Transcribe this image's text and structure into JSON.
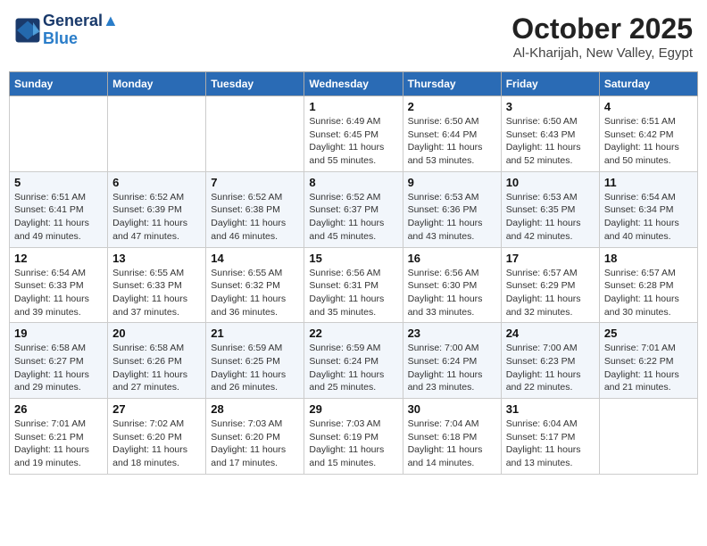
{
  "header": {
    "logo_line1": "General",
    "logo_line2": "Blue",
    "title": "October 2025",
    "subtitle": "Al-Kharijah, New Valley, Egypt"
  },
  "days_of_week": [
    "Sunday",
    "Monday",
    "Tuesday",
    "Wednesday",
    "Thursday",
    "Friday",
    "Saturday"
  ],
  "weeks": [
    [
      {
        "day": "",
        "info": ""
      },
      {
        "day": "",
        "info": ""
      },
      {
        "day": "",
        "info": ""
      },
      {
        "day": "1",
        "info": "Sunrise: 6:49 AM\nSunset: 6:45 PM\nDaylight: 11 hours\nand 55 minutes."
      },
      {
        "day": "2",
        "info": "Sunrise: 6:50 AM\nSunset: 6:44 PM\nDaylight: 11 hours\nand 53 minutes."
      },
      {
        "day": "3",
        "info": "Sunrise: 6:50 AM\nSunset: 6:43 PM\nDaylight: 11 hours\nand 52 minutes."
      },
      {
        "day": "4",
        "info": "Sunrise: 6:51 AM\nSunset: 6:42 PM\nDaylight: 11 hours\nand 50 minutes."
      }
    ],
    [
      {
        "day": "5",
        "info": "Sunrise: 6:51 AM\nSunset: 6:41 PM\nDaylight: 11 hours\nand 49 minutes."
      },
      {
        "day": "6",
        "info": "Sunrise: 6:52 AM\nSunset: 6:39 PM\nDaylight: 11 hours\nand 47 minutes."
      },
      {
        "day": "7",
        "info": "Sunrise: 6:52 AM\nSunset: 6:38 PM\nDaylight: 11 hours\nand 46 minutes."
      },
      {
        "day": "8",
        "info": "Sunrise: 6:52 AM\nSunset: 6:37 PM\nDaylight: 11 hours\nand 45 minutes."
      },
      {
        "day": "9",
        "info": "Sunrise: 6:53 AM\nSunset: 6:36 PM\nDaylight: 11 hours\nand 43 minutes."
      },
      {
        "day": "10",
        "info": "Sunrise: 6:53 AM\nSunset: 6:35 PM\nDaylight: 11 hours\nand 42 minutes."
      },
      {
        "day": "11",
        "info": "Sunrise: 6:54 AM\nSunset: 6:34 PM\nDaylight: 11 hours\nand 40 minutes."
      }
    ],
    [
      {
        "day": "12",
        "info": "Sunrise: 6:54 AM\nSunset: 6:33 PM\nDaylight: 11 hours\nand 39 minutes."
      },
      {
        "day": "13",
        "info": "Sunrise: 6:55 AM\nSunset: 6:33 PM\nDaylight: 11 hours\nand 37 minutes."
      },
      {
        "day": "14",
        "info": "Sunrise: 6:55 AM\nSunset: 6:32 PM\nDaylight: 11 hours\nand 36 minutes."
      },
      {
        "day": "15",
        "info": "Sunrise: 6:56 AM\nSunset: 6:31 PM\nDaylight: 11 hours\nand 35 minutes."
      },
      {
        "day": "16",
        "info": "Sunrise: 6:56 AM\nSunset: 6:30 PM\nDaylight: 11 hours\nand 33 minutes."
      },
      {
        "day": "17",
        "info": "Sunrise: 6:57 AM\nSunset: 6:29 PM\nDaylight: 11 hours\nand 32 minutes."
      },
      {
        "day": "18",
        "info": "Sunrise: 6:57 AM\nSunset: 6:28 PM\nDaylight: 11 hours\nand 30 minutes."
      }
    ],
    [
      {
        "day": "19",
        "info": "Sunrise: 6:58 AM\nSunset: 6:27 PM\nDaylight: 11 hours\nand 29 minutes."
      },
      {
        "day": "20",
        "info": "Sunrise: 6:58 AM\nSunset: 6:26 PM\nDaylight: 11 hours\nand 27 minutes."
      },
      {
        "day": "21",
        "info": "Sunrise: 6:59 AM\nSunset: 6:25 PM\nDaylight: 11 hours\nand 26 minutes."
      },
      {
        "day": "22",
        "info": "Sunrise: 6:59 AM\nSunset: 6:24 PM\nDaylight: 11 hours\nand 25 minutes."
      },
      {
        "day": "23",
        "info": "Sunrise: 7:00 AM\nSunset: 6:24 PM\nDaylight: 11 hours\nand 23 minutes."
      },
      {
        "day": "24",
        "info": "Sunrise: 7:00 AM\nSunset: 6:23 PM\nDaylight: 11 hours\nand 22 minutes."
      },
      {
        "day": "25",
        "info": "Sunrise: 7:01 AM\nSunset: 6:22 PM\nDaylight: 11 hours\nand 21 minutes."
      }
    ],
    [
      {
        "day": "26",
        "info": "Sunrise: 7:01 AM\nSunset: 6:21 PM\nDaylight: 11 hours\nand 19 minutes."
      },
      {
        "day": "27",
        "info": "Sunrise: 7:02 AM\nSunset: 6:20 PM\nDaylight: 11 hours\nand 18 minutes."
      },
      {
        "day": "28",
        "info": "Sunrise: 7:03 AM\nSunset: 6:20 PM\nDaylight: 11 hours\nand 17 minutes."
      },
      {
        "day": "29",
        "info": "Sunrise: 7:03 AM\nSunset: 6:19 PM\nDaylight: 11 hours\nand 15 minutes."
      },
      {
        "day": "30",
        "info": "Sunrise: 7:04 AM\nSunset: 6:18 PM\nDaylight: 11 hours\nand 14 minutes."
      },
      {
        "day": "31",
        "info": "Sunrise: 6:04 AM\nSunset: 5:17 PM\nDaylight: 11 hours\nand 13 minutes."
      },
      {
        "day": "",
        "info": ""
      }
    ]
  ]
}
